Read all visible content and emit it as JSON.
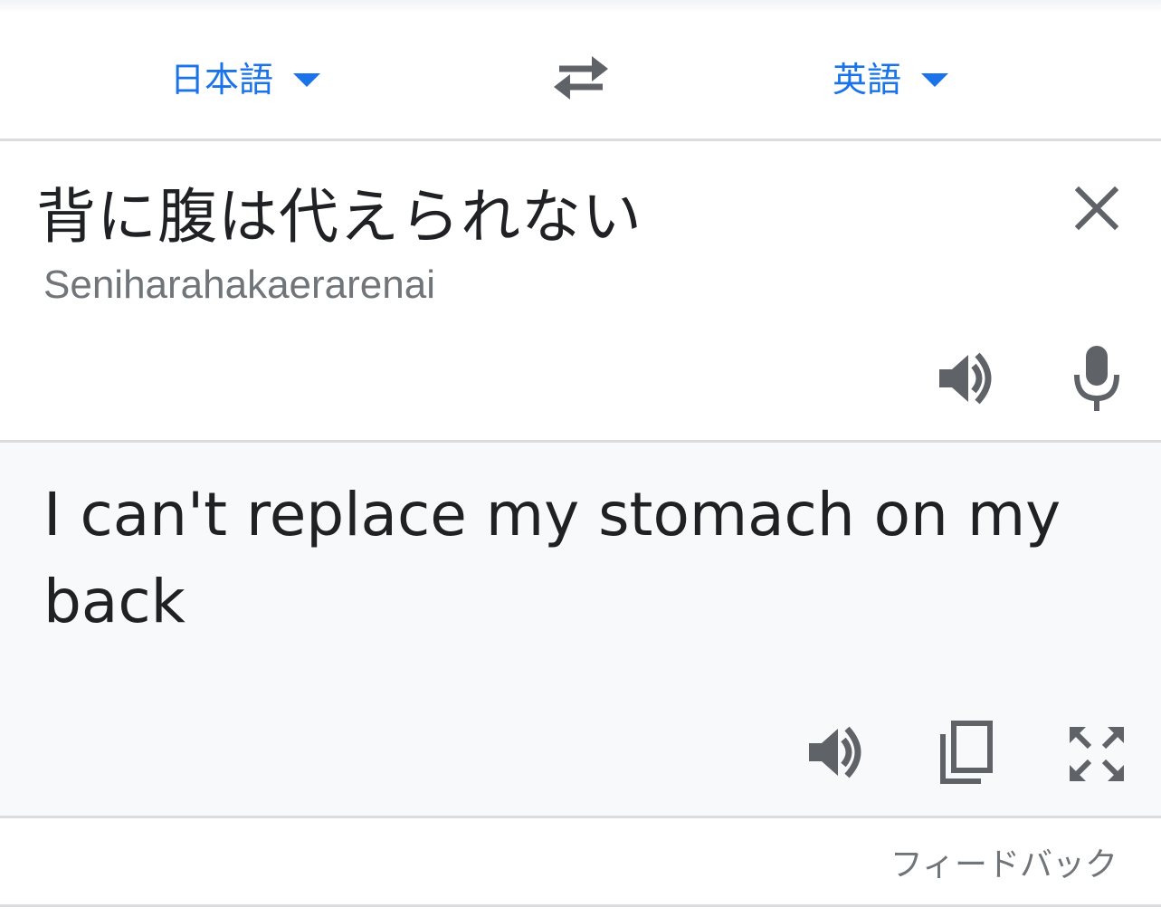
{
  "language_bar": {
    "source_language": "日本語",
    "target_language": "英語"
  },
  "source": {
    "text": "背に腹は代えられない",
    "romanization": "Seniharahakaerarenai"
  },
  "result": {
    "text": "I can't replace my stomach on my back"
  },
  "footer": {
    "feedback_label": "フィードバック"
  },
  "icons": {
    "swap": "swap-arrows-icon",
    "clear": "close-icon",
    "speaker": "speaker-icon",
    "microphone": "microphone-icon",
    "copy": "copy-icon",
    "fullscreen": "fullscreen-icon",
    "dropdown": "caret-down-icon"
  },
  "colors": {
    "accent": "#1a73e8",
    "text_primary": "#202124",
    "text_secondary": "#70757a",
    "icon": "#5f6368",
    "result_background": "#f8f9fa",
    "divider": "#dadce0"
  }
}
